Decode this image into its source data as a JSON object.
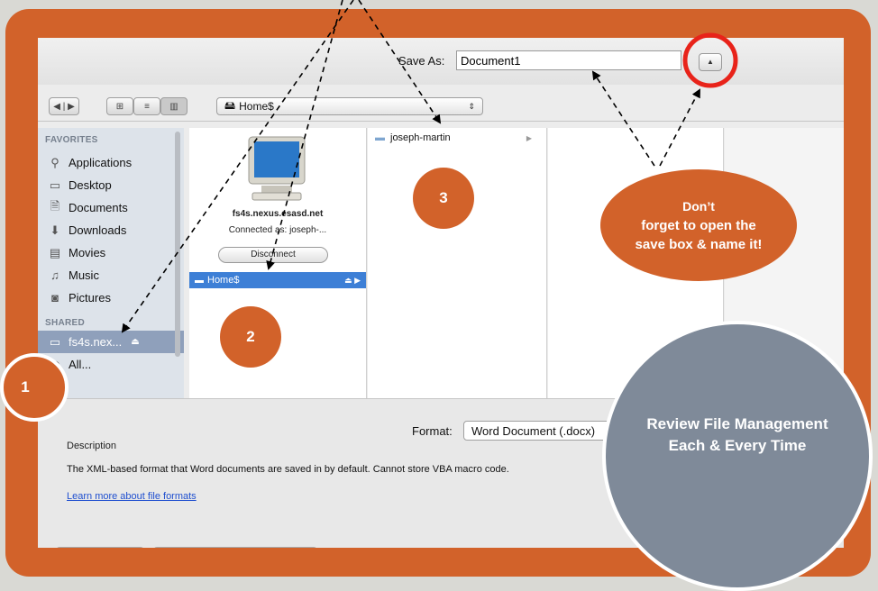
{
  "dialog": {
    "save_as_label": "Save As:",
    "save_as_value": "Document1",
    "expand_icon": "triangle-up-icon",
    "nav_back": "◀",
    "nav_forward": "▶",
    "location_popup": "Home$",
    "sidebar": {
      "favorites_header": "FAVORITES",
      "favorites": [
        {
          "label": "Applications",
          "icon": "applications-icon"
        },
        {
          "label": "Desktop",
          "icon": "desktop-icon"
        },
        {
          "label": "Documents",
          "icon": "documents-icon"
        },
        {
          "label": "Downloads",
          "icon": "downloads-icon"
        },
        {
          "label": "Movies",
          "icon": "movies-icon"
        },
        {
          "label": "Music",
          "icon": "music-icon"
        },
        {
          "label": "Pictures",
          "icon": "pictures-icon"
        }
      ],
      "shared_header": "SHARED",
      "shared": [
        {
          "label": "fs4s.nex...",
          "icon": "server-icon"
        },
        {
          "label": "All...",
          "icon": "network-icon"
        }
      ]
    },
    "column1": {
      "server_name": "fs4s.nexus.esasd.net",
      "connection": "Connected as: joseph-...",
      "disconnect_label": "Disconnect",
      "home_item": "Home$"
    },
    "column2": {
      "item": "joseph-martin"
    },
    "format_label": "Format:",
    "format_value": "Word Document (.docx)",
    "description_label": "Description",
    "description_text": "The XML-based format that Word documents are saved in by default. Cannot store VBA macro code.",
    "learn_more": "Learn more about file formats"
  },
  "annotations": {
    "step1": "1",
    "step2": "2",
    "step3": "3",
    "callout_line1": "Don’t",
    "callout_line2": "forget to open the",
    "callout_line3": "save box & name it!",
    "review_line1": "Review File Management",
    "review_line2": "Each & Every Time"
  },
  "colors": {
    "frame": "#d2622a",
    "review_circle": "#7f8a99",
    "selection": "#3d7fd6",
    "highlight_ring": "#e8231a"
  }
}
